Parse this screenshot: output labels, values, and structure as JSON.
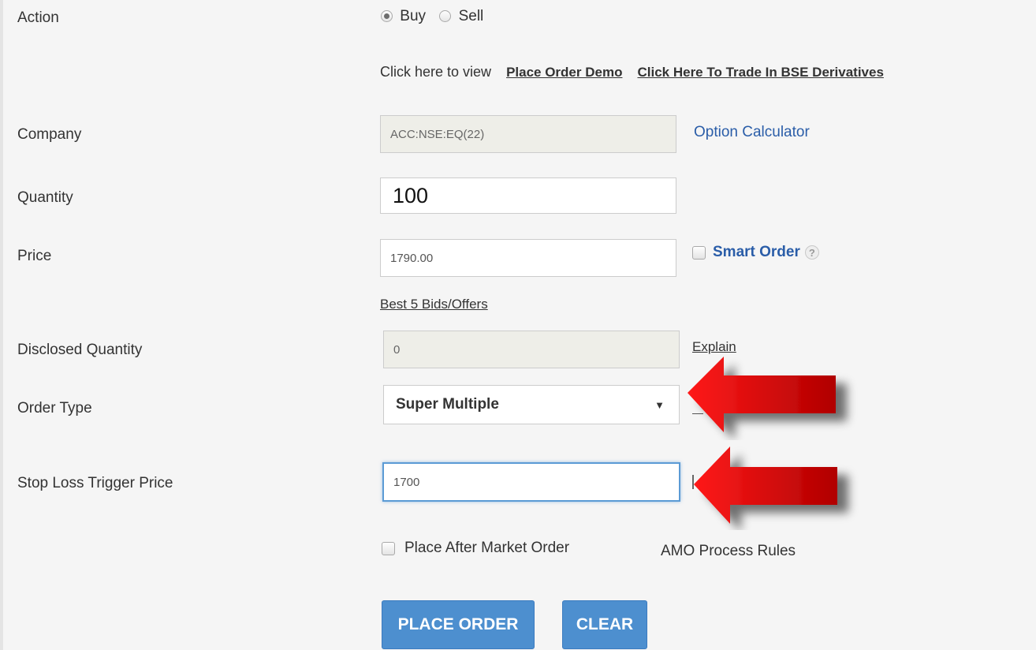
{
  "action": {
    "label": "Action",
    "buy_label": "Buy",
    "sell_label": "Sell",
    "selected": "Buy"
  },
  "links_row": {
    "prefix": "Click here to view",
    "demo": "Place Order Demo",
    "bse": "Click Here To Trade In BSE Derivatives"
  },
  "company": {
    "label": "Company",
    "value": "ACC:NSE:EQ(22)",
    "option_calculator": "Option Calculator"
  },
  "quantity": {
    "label": "Quantity",
    "value": "100"
  },
  "price": {
    "label": "Price",
    "value": "1790.00",
    "smart_order": "Smart Order",
    "help": "?",
    "best_bids": "Best 5 Bids/Offers"
  },
  "disclosed_quantity": {
    "label": "Disclosed Quantity",
    "value": "0",
    "explain": "Explain"
  },
  "order_type": {
    "label": "Order Type",
    "selected": "Super Multiple",
    "caret": "▼"
  },
  "stop_loss": {
    "label": "Stop Loss Trigger Price",
    "value": "1700"
  },
  "amo": {
    "checkbox_label": "Place After Market Order",
    "rules_link": "AMO Process Rules"
  },
  "buttons": {
    "place_order": "PLACE ORDER",
    "clear": "CLEAR"
  },
  "colors": {
    "button_blue": "#4d8fcf",
    "link_blue": "#2a5da8",
    "arrow_red": "#d40000"
  }
}
